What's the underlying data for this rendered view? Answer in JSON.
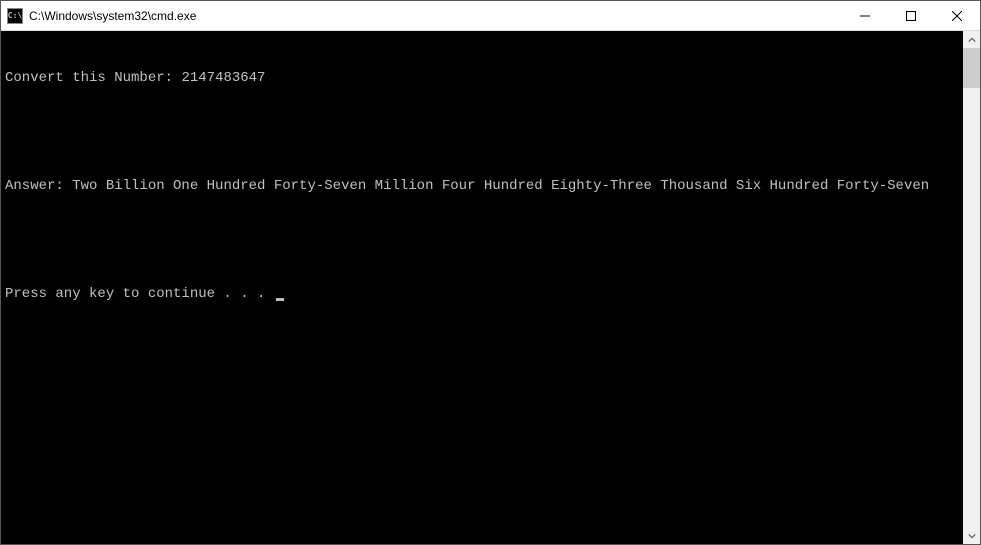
{
  "window": {
    "title": "C:\\Windows\\system32\\cmd.exe",
    "icon_label": "C:\\"
  },
  "console": {
    "line1_prompt": "Convert this Number: ",
    "line1_value": "2147483647",
    "line2_label": "Answer: ",
    "line2_value": "Two Billion One Hundred Forty-Seven Million Four Hundred Eighty-Three Thousand Six Hundred Forty-Seven",
    "line3": "Press any key to continue . . . "
  }
}
